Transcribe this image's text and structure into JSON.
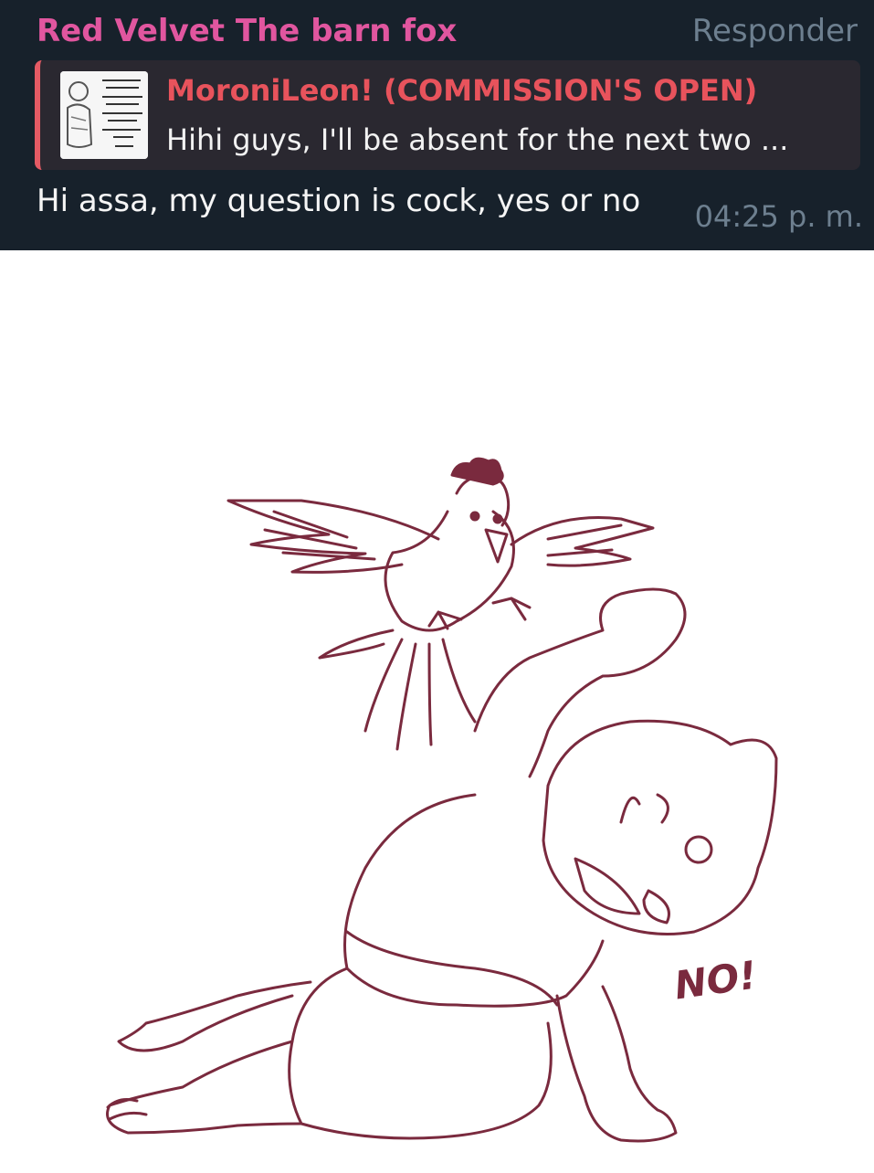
{
  "message": {
    "sender": "Red Velvet The barn fox",
    "reply_label": "Responder",
    "quote": {
      "author": "MoroniLeon! (COMMISSION'S OPEN)",
      "text": "Hihi guys, I'll be absent for the next two ..."
    },
    "text": "Hi assa, my question is cock, yes or no",
    "time": "04:25 p. m."
  },
  "drawing": {
    "exclamation": "NO!",
    "line_color": "#7a2a3e"
  }
}
